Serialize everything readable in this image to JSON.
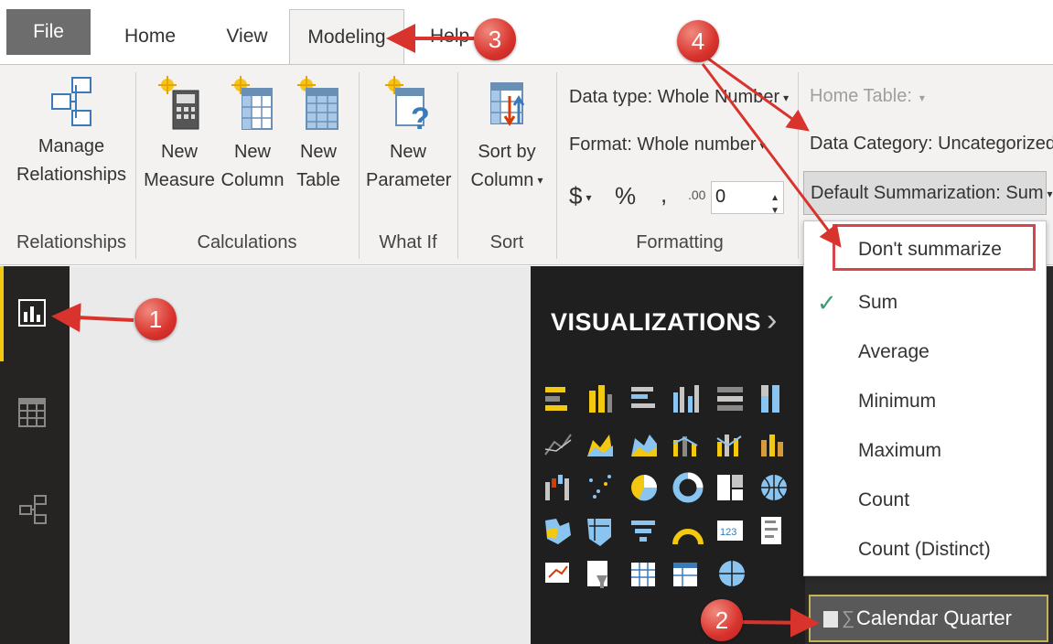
{
  "menu": {
    "file": "File",
    "home": "Home",
    "view": "View",
    "modeling": "Modeling",
    "help": "Help"
  },
  "ribbon": {
    "manage_relationships": [
      "Manage",
      "Relationships"
    ],
    "new_measure": [
      "New",
      "Measure"
    ],
    "new_column": [
      "New",
      "Column"
    ],
    "new_table": [
      "New",
      "Table"
    ],
    "new_parameter": [
      "New",
      "Parameter"
    ],
    "sort_by_column": [
      "Sort by",
      "Column"
    ],
    "groups": {
      "relationships": "Relationships",
      "calculations": "Calculations",
      "what_if": "What If",
      "sort": "Sort",
      "formatting": "Formatting"
    },
    "formatting": {
      "data_type": "Data type: Whole Number",
      "format": "Format: Whole number",
      "currency": "$",
      "percent": "%",
      "comma": ",",
      "decimals_label": ".00",
      "decimals_value": "0"
    },
    "properties": {
      "home_table": "Home Table:",
      "data_category": "Data Category: Uncategorized",
      "default_summarization": "Default Summarization: Sum"
    }
  },
  "visualizations": {
    "header": "VISUALIZATIONS",
    "expand": "›"
  },
  "dropdown": {
    "selected": "Sum",
    "items": [
      "Don't summarize",
      "Sum",
      "Average",
      "Minimum",
      "Maximum",
      "Count",
      "Count (Distinct)"
    ]
  },
  "fields": {
    "calendar_quarter": "Calendar Quarter",
    "sigma": "∑"
  },
  "callouts": [
    "1",
    "2",
    "3",
    "4"
  ],
  "colors": {
    "accent_yellow": "#f2c811",
    "callout_red": "#d8332d",
    "highlight_red": "#d6454b",
    "check_green": "#3a9e72",
    "dark_pane": "#1f1f1f"
  }
}
